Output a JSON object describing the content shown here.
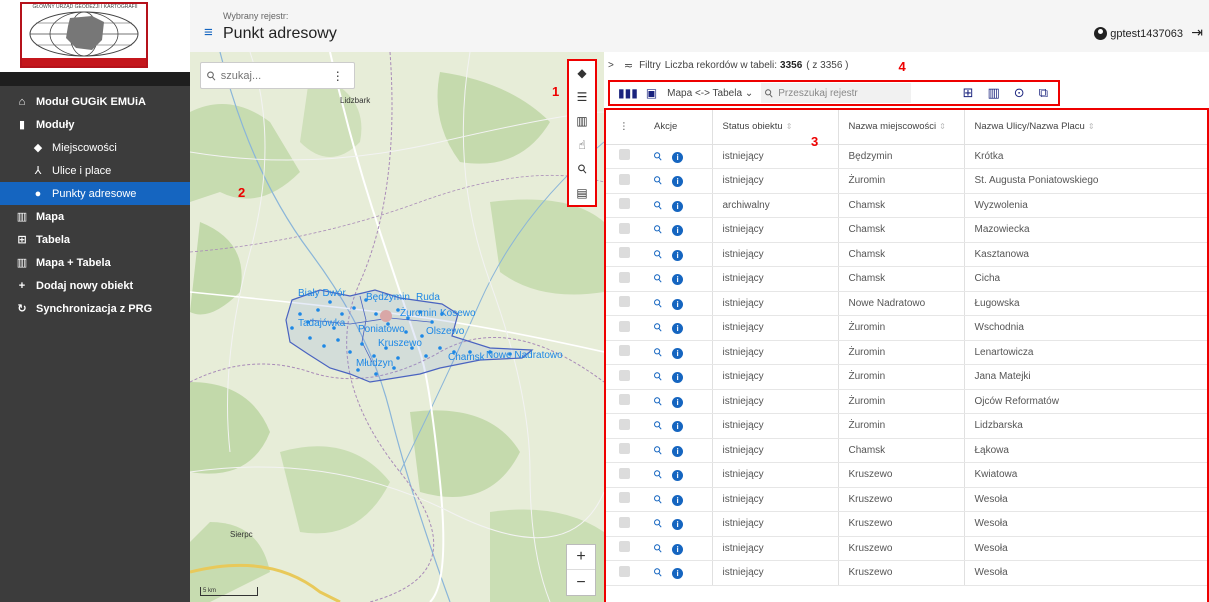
{
  "sidebar": {
    "logo_caption": "GŁÓWNY URZĄD GEODEZJI I KARTOGRAFII",
    "items": [
      {
        "label": "Moduł GUGiK EMUiA",
        "icon": "home-icon",
        "level": 0
      },
      {
        "label": "Moduły",
        "icon": "book-icon",
        "level": 0
      },
      {
        "label": "Miejscowości",
        "icon": "layers-icon",
        "level": 1
      },
      {
        "label": "Ulice i place",
        "icon": "road-icon",
        "level": 1
      },
      {
        "label": "Punkty adresowe",
        "icon": "pin-icon",
        "level": 1,
        "active": true
      },
      {
        "label": "Mapa",
        "icon": "map-icon",
        "level": 0
      },
      {
        "label": "Tabela",
        "icon": "table-icon",
        "level": 0
      },
      {
        "label": "Mapa + Tabela",
        "icon": "map-icon",
        "level": 0
      },
      {
        "label": "Dodaj nowy obiekt",
        "icon": "plus-icon",
        "level": 0
      },
      {
        "label": "Synchronizacja z PRG",
        "icon": "sync-icon",
        "level": 0
      }
    ]
  },
  "header": {
    "caption": "Wybrany rejestr:",
    "title": "Punkt adresowy",
    "user": "gptest1437063"
  },
  "map": {
    "search_placeholder": "szukaj...",
    "callout_toolbar": "1",
    "callout_map": "2",
    "labels": {
      "lidzbark": "Lidzbark",
      "sierpc": "Sierpc",
      "scale": "5 km"
    },
    "places": [
      "Biały Dwór",
      "Będzymin",
      "Ruda",
      "Żuromin",
      "Kosewo",
      "Tadajówka",
      "Poniatowo",
      "Olszewo",
      "Kruszewo",
      "Chamsk",
      "Nowe Nadratowo",
      "Młudzyn"
    ],
    "zoom_in": "+",
    "zoom_out": "−"
  },
  "filter": {
    "expand": ">",
    "label": "Filtry",
    "count_label": "Liczba rekordów w tabeli:",
    "count": "3356",
    "total": "( z 3356 )",
    "callout": "4"
  },
  "toolbar": {
    "view_select": "Mapa <-> Tabela",
    "search_placeholder": "Przeszukaj rejestr"
  },
  "table": {
    "callout": "3",
    "headers": {
      "actions": "Akcje",
      "status": "Status obiektu",
      "town": "Nazwa miejscowości",
      "street": "Nazwa Ulicy/Nazwa Placu"
    },
    "rows": [
      {
        "status": "istniejący",
        "town": "Będzymin",
        "street": "Krótka"
      },
      {
        "status": "istniejący",
        "town": "Żuromin",
        "street": "St. Augusta Poniatowskiego"
      },
      {
        "status": "archiwalny",
        "town": "Chamsk",
        "street": "Wyzwolenia"
      },
      {
        "status": "istniejący",
        "town": "Chamsk",
        "street": "Mazowiecka"
      },
      {
        "status": "istniejący",
        "town": "Chamsk",
        "street": "Kasztanowa"
      },
      {
        "status": "istniejący",
        "town": "Chamsk",
        "street": "Cicha"
      },
      {
        "status": "istniejący",
        "town": "Nowe Nadratowo",
        "street": "Ługowska"
      },
      {
        "status": "istniejący",
        "town": "Żuromin",
        "street": "Wschodnia"
      },
      {
        "status": "istniejący",
        "town": "Żuromin",
        "street": "Lenartowicza"
      },
      {
        "status": "istniejący",
        "town": "Żuromin",
        "street": "Jana Matejki"
      },
      {
        "status": "istniejący",
        "town": "Żuromin",
        "street": "Ojców Reformatów"
      },
      {
        "status": "istniejący",
        "town": "Żuromin",
        "street": "Lidzbarska"
      },
      {
        "status": "istniejący",
        "town": "Chamsk",
        "street": "Łąkowa"
      },
      {
        "status": "istniejący",
        "town": "Kruszewo",
        "street": "Kwiatowa"
      },
      {
        "status": "istniejący",
        "town": "Kruszewo",
        "street": "Wesoła"
      },
      {
        "status": "istniejący",
        "town": "Kruszewo",
        "street": "Wesoła"
      },
      {
        "status": "istniejący",
        "town": "Kruszewo",
        "street": "Wesoła"
      },
      {
        "status": "istniejący",
        "town": "Kruszewo",
        "street": "Wesoła"
      }
    ]
  },
  "colors": {
    "accent": "#1565c0",
    "sidebar": "#3c3c3c",
    "highlight": "#e00000"
  }
}
